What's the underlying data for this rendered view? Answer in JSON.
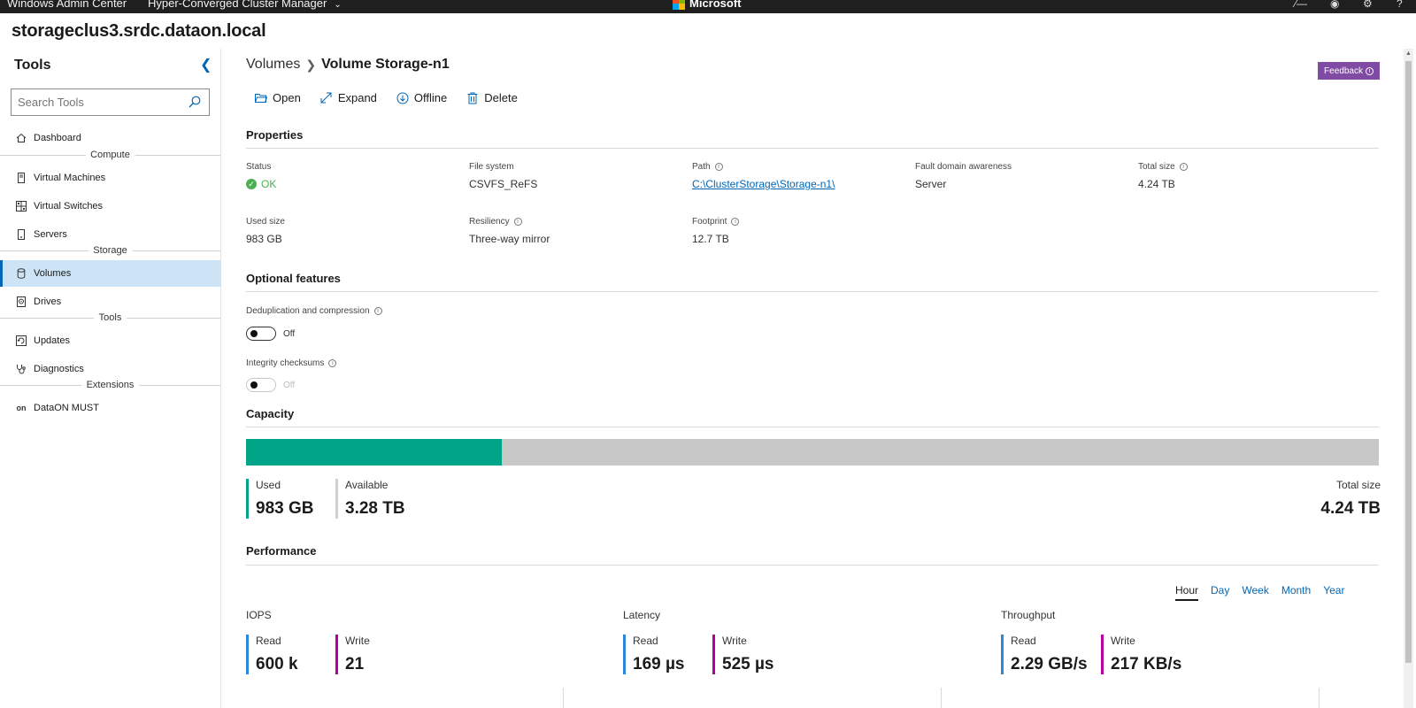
{
  "topbar": {
    "brand": "Windows Admin Center",
    "app": "Hyper-Converged Cluster Manager",
    "microsoft": "Microsoft"
  },
  "host": "storageclus3.srdc.dataon.local",
  "sidebar": {
    "title": "Tools",
    "search_placeholder": "Search Tools",
    "items": [
      {
        "label": "Dashboard",
        "icon": "home-icon"
      },
      {
        "label": "Virtual Machines",
        "icon": "vm-icon"
      },
      {
        "label": "Virtual Switches",
        "icon": "switch-icon"
      },
      {
        "label": "Servers",
        "icon": "server-icon"
      },
      {
        "label": "Volumes",
        "icon": "volume-icon"
      },
      {
        "label": "Drives",
        "icon": "drive-icon"
      },
      {
        "label": "Updates",
        "icon": "updates-icon"
      },
      {
        "label": "Diagnostics",
        "icon": "stethoscope-icon"
      },
      {
        "label": "DataON MUST",
        "icon": "dataon-icon",
        "icon_text": "on"
      }
    ],
    "sections": [
      "Compute",
      "Storage",
      "Tools",
      "Extensions"
    ]
  },
  "breadcrumb": {
    "parent": "Volumes",
    "current": "Volume Storage-n1"
  },
  "feedback_label": "Feedback",
  "toolbar": {
    "open": "Open",
    "expand": "Expand",
    "offline": "Offline",
    "delete": "Delete"
  },
  "properties": {
    "title": "Properties",
    "status_label": "Status",
    "status_value": "OK",
    "filesystem_label": "File system",
    "filesystem_value": "CSVFS_ReFS",
    "path_label": "Path",
    "path_value": "C:\\ClusterStorage\\Storage-n1\\",
    "fault_label": "Fault domain awareness",
    "fault_value": "Server",
    "total_label": "Total size",
    "total_value": "4.24 TB",
    "used_label": "Used size",
    "used_value": "983 GB",
    "resiliency_label": "Resiliency",
    "resiliency_value": "Three-way mirror",
    "footprint_label": "Footprint",
    "footprint_value": "12.7 TB"
  },
  "optional": {
    "title": "Optional features",
    "dedup_label": "Deduplication and compression",
    "dedup_state": "Off",
    "integrity_label": "Integrity checksums",
    "integrity_state": "Off"
  },
  "capacity": {
    "title": "Capacity",
    "used_fraction": 0.226,
    "used_label": "Used",
    "used_value": "983 GB",
    "available_label": "Available",
    "available_value": "3.28 TB",
    "total_label": "Total size",
    "total_value": "4.24 TB",
    "used_color": "#00a487",
    "available_color": "#c8c8c8"
  },
  "performance": {
    "title": "Performance",
    "ranges": [
      "Hour",
      "Day",
      "Week",
      "Month",
      "Year"
    ],
    "active_range": "Hour",
    "iops": {
      "title": "IOPS",
      "read_label": "Read",
      "read_value": "600 k",
      "write_label": "Write",
      "write_value": "21"
    },
    "latency": {
      "title": "Latency",
      "read_label": "Read",
      "read_value": "169 µs",
      "write_label": "Write",
      "write_value": "525 µs"
    },
    "throughput": {
      "title": "Throughput",
      "read_label": "Read",
      "read_value": "2.29 GB/s",
      "write_label": "Write",
      "write_value": "217 KB/s"
    },
    "read_color": "#2b88d8",
    "write_color": "#b4009e"
  }
}
